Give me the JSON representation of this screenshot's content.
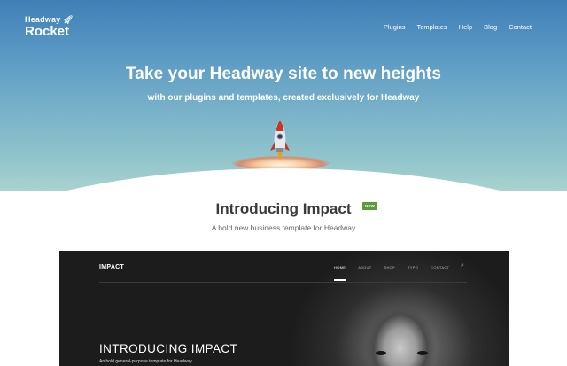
{
  "header": {
    "logo_top": "Headway",
    "logo_bottom": "Rocket",
    "nav": [
      "Plugins",
      "Templates",
      "Help",
      "Blog",
      "Contact"
    ]
  },
  "hero": {
    "title": "Take your Headway site to new heights",
    "subtitle": "with our plugins and templates, created exclusively for Headway"
  },
  "intro": {
    "title": "Introducing Impact",
    "badge": "NEW",
    "subtitle": "A bold new business template for Headway"
  },
  "preview": {
    "logo": "IMPACT",
    "nav": [
      "HOME",
      "ABOUT",
      "SHOP",
      "TYPO",
      "CONTACT"
    ],
    "active_nav": "HOME",
    "heading": "INTRODUCING IMPACT",
    "tagline": "An bold general-purpose template for Headway"
  },
  "colors": {
    "hero_top": "#3f7fb6",
    "hero_bottom": "#a9d2cf",
    "badge": "#5a9a3c",
    "preview_bg": "#1e1e1e"
  }
}
